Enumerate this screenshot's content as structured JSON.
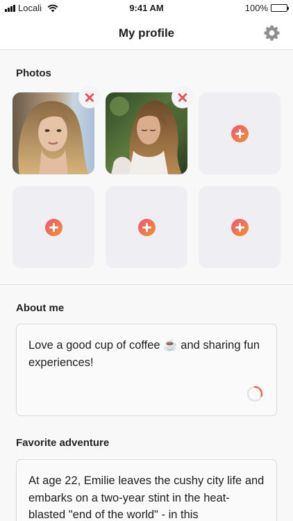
{
  "status_bar": {
    "carrier": "Locali",
    "time": "9:41 AM",
    "battery": "100%"
  },
  "header": {
    "title": "My profile"
  },
  "photos": {
    "title": "Photos",
    "tiles": [
      {
        "state": "photo",
        "removable": true
      },
      {
        "state": "photo",
        "removable": true
      },
      {
        "state": "empty"
      },
      {
        "state": "empty"
      },
      {
        "state": "empty"
      },
      {
        "state": "empty"
      }
    ]
  },
  "about": {
    "title": "About me",
    "text": "Love a good cup of coffee ☕ and sharing fun experiences!"
  },
  "adventure": {
    "title": "Favorite adventure",
    "text": "At age 22, Emilie leaves the cushy city life and embarks on a two-year stint in the heat-blasted \"end of the world\" - in this"
  },
  "colors": {
    "accent_gradient_start": "#f0537a",
    "accent_gradient_end": "#f0932c",
    "remove": "#e5545b"
  },
  "icons": {
    "settings": "gear-icon",
    "add": "plus-circle-icon",
    "remove": "close-icon",
    "loading": "spinner-icon"
  }
}
